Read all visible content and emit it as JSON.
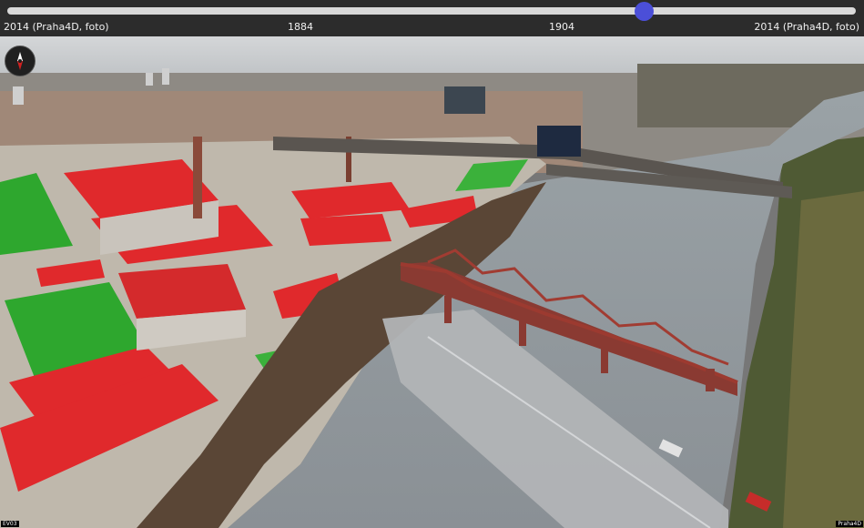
{
  "timeline": {
    "start_label": "2014 (Praha4D, foto)",
    "mid_label_1": "1884",
    "mid_label_2": "1904",
    "end_label": "2014 (Praha4D, foto)",
    "slider_value_fraction": 0.75
  },
  "overlay": {
    "corner_left": "EV03",
    "corner_right": "Praha4D"
  },
  "colors": {
    "accent": "#4b4fd8",
    "building_red": "#e0292c",
    "vegetation_green": "#2ea72e",
    "river": "#a8a8a8"
  },
  "icons": {
    "compass": "compass-icon"
  }
}
